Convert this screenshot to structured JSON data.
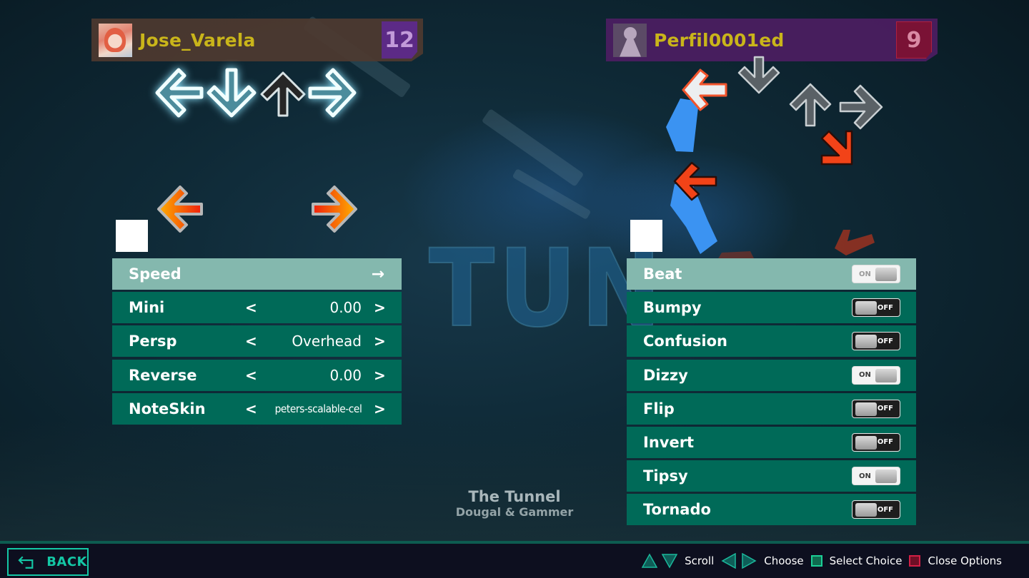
{
  "players": [
    {
      "name": "Jose_Varela",
      "level": "12",
      "avatar": "anime-avatar",
      "bar_color": "#4e3a30",
      "badge_color": "#5c2a86",
      "options": [
        {
          "label": "Speed",
          "type": "submenu",
          "icon": "right-arrow-icon",
          "selected": true
        },
        {
          "label": "Mini",
          "type": "choice",
          "value": "0.00"
        },
        {
          "label": "Persp",
          "type": "choice",
          "value": "Overhead"
        },
        {
          "label": "Reverse",
          "type": "choice",
          "value": "0.00"
        },
        {
          "label": "NoteSkin",
          "type": "choice",
          "value": "peters-scalable-cel"
        }
      ]
    },
    {
      "name": "Perfil0001ed",
      "level": "9",
      "avatar": "default-avatar",
      "bar_color": "#501e64",
      "badge_color": "#7a1235",
      "options": [
        {
          "label": "Beat",
          "type": "toggle",
          "state": "ON",
          "selected": true
        },
        {
          "label": "Bumpy",
          "type": "toggle",
          "state": "OFF"
        },
        {
          "label": "Confusion",
          "type": "toggle",
          "state": "OFF"
        },
        {
          "label": "Dizzy",
          "type": "toggle",
          "state": "ON"
        },
        {
          "label": "Flip",
          "type": "toggle",
          "state": "OFF"
        },
        {
          "label": "Invert",
          "type": "toggle",
          "state": "OFF"
        },
        {
          "label": "Tipsy",
          "type": "toggle",
          "state": "ON"
        },
        {
          "label": "Tornado",
          "type": "toggle",
          "state": "OFF"
        }
      ]
    }
  ],
  "choice_prev": "<",
  "choice_next": ">",
  "submenu_arrow": "→",
  "song": {
    "title": "The Tunnel",
    "artist": "Dougal & Gammer",
    "background_text": "TUN"
  },
  "footer": {
    "back_label": "BACK",
    "hints": [
      {
        "icons": [
          "up-triangle-icon",
          "down-triangle-icon"
        ],
        "label": "Scroll"
      },
      {
        "icons": [
          "left-triangle-icon",
          "right-triangle-icon"
        ],
        "label": "Choose"
      },
      {
        "icons": [
          "green-square-icon"
        ],
        "label": "Select Choice"
      },
      {
        "icons": [
          "red-square-icon"
        ],
        "label": "Close Options"
      }
    ]
  },
  "colors": {
    "row": "#006a58",
    "row_selected": "#84b8ae",
    "accent": "#14c7a5",
    "name": "#c9b51a"
  }
}
